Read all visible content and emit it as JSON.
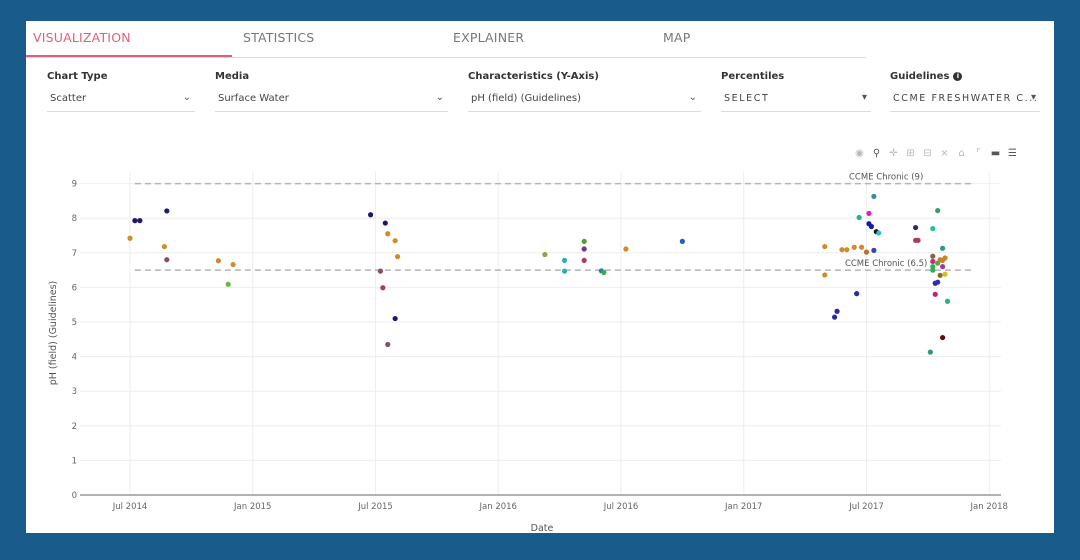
{
  "tabs": [
    {
      "label": "VISUALIZATION",
      "active": true
    },
    {
      "label": "STATISTICS",
      "active": false
    },
    {
      "label": "EXPLAINER",
      "active": false
    },
    {
      "label": "MAP",
      "active": false
    }
  ],
  "controls": {
    "chart_type": {
      "label": "Chart Type",
      "value": "Scatter"
    },
    "media": {
      "label": "Media",
      "value": "Surface Water"
    },
    "characteristics": {
      "label": "Characteristics (Y-Axis)",
      "value": "pH (field) (Guidelines)"
    },
    "percentiles": {
      "label": "Percentiles",
      "value": "SELECT"
    },
    "guidelines": {
      "label": "Guidelines",
      "value": "CCME FRESHWATER C..."
    }
  },
  "modebar": [
    "camera-icon",
    "zoom-icon",
    "pan-icon",
    "zoom-in-icon",
    "zoom-out-icon",
    "autoscale-icon",
    "reset-axes-icon",
    "spike-lines-icon",
    "hover-closest-icon",
    "hover-compare-icon"
  ],
  "colors": {
    "frame": "#195b8a",
    "accent": "#e0607a",
    "guideline": "#b5b5b5"
  },
  "chart_data": {
    "type": "scatter",
    "title": "",
    "xlabel": "Date",
    "ylabel": "pH (field) (Guidelines)",
    "xlim": [
      2014.2,
      2018.0
    ],
    "ylim": [
      0,
      9.35
    ],
    "xticks": [
      {
        "value": 2014.5,
        "label": "Jul 2014"
      },
      {
        "value": 2015.0,
        "label": "Jan 2015"
      },
      {
        "value": 2015.5,
        "label": "Jul 2015"
      },
      {
        "value": 2016.0,
        "label": "Jan 2016"
      },
      {
        "value": 2016.5,
        "label": "Jul 2016"
      },
      {
        "value": 2017.0,
        "label": "Jan 2017"
      },
      {
        "value": 2017.5,
        "label": "Jul 2017"
      },
      {
        "value": 2018.0,
        "label": "Jan 2018"
      }
    ],
    "yticks": [
      0,
      1,
      2,
      3,
      4,
      5,
      6,
      7,
      8,
      9
    ],
    "grid": true,
    "guidelines": [
      {
        "label": "CCME Chronic (9)",
        "value": 9
      },
      {
        "label": "CCME Chronic (6.5)",
        "value": 6.5
      }
    ],
    "points": [
      {
        "x": 2014.5,
        "y": 7.42,
        "color": "#d08b2b"
      },
      {
        "x": 2014.52,
        "y": 7.93,
        "color": "#1a1a6e"
      },
      {
        "x": 2014.54,
        "y": 7.93,
        "color": "#1a1a6e"
      },
      {
        "x": 2014.65,
        "y": 8.21,
        "color": "#1a1a6e"
      },
      {
        "x": 2014.64,
        "y": 7.18,
        "color": "#d08b2b"
      },
      {
        "x": 2014.65,
        "y": 6.8,
        "color": "#8e4a6e"
      },
      {
        "x": 2014.86,
        "y": 6.77,
        "color": "#d08b2b"
      },
      {
        "x": 2014.9,
        "y": 6.09,
        "color": "#6aba3a"
      },
      {
        "x": 2014.92,
        "y": 6.66,
        "color": "#d08b2b"
      },
      {
        "x": 2015.48,
        "y": 8.1,
        "color": "#1a1a6e"
      },
      {
        "x": 2015.52,
        "y": 6.47,
        "color": "#8e4a6e"
      },
      {
        "x": 2015.53,
        "y": 5.99,
        "color": "#b03a5a"
      },
      {
        "x": 2015.54,
        "y": 7.86,
        "color": "#1a1a6e"
      },
      {
        "x": 2015.55,
        "y": 7.55,
        "color": "#d08b2b"
      },
      {
        "x": 2015.55,
        "y": 4.35,
        "color": "#8e4a6e"
      },
      {
        "x": 2015.58,
        "y": 7.35,
        "color": "#d08b2b"
      },
      {
        "x": 2015.58,
        "y": 5.1,
        "color": "#1a1a6e"
      },
      {
        "x": 2015.59,
        "y": 6.89,
        "color": "#d08b2b"
      },
      {
        "x": 2016.19,
        "y": 6.95,
        "color": "#9aa042"
      },
      {
        "x": 2016.27,
        "y": 6.78,
        "color": "#2ab0b0"
      },
      {
        "x": 2016.27,
        "y": 6.47,
        "color": "#2ab0b0"
      },
      {
        "x": 2016.35,
        "y": 7.33,
        "color": "#5a9a3a"
      },
      {
        "x": 2016.35,
        "y": 7.11,
        "color": "#6a3a9a"
      },
      {
        "x": 2016.35,
        "y": 6.78,
        "color": "#b03a5a"
      },
      {
        "x": 2016.42,
        "y": 6.48,
        "color": "#2a7ac0"
      },
      {
        "x": 2016.43,
        "y": 6.43,
        "color": "#3ab04a"
      },
      {
        "x": 2016.52,
        "y": 7.11,
        "color": "#d08b2b"
      },
      {
        "x": 2016.75,
        "y": 7.33,
        "color": "#2a5ac0"
      },
      {
        "x": 2017.33,
        "y": 6.36,
        "color": "#d08b2b"
      },
      {
        "x": 2017.33,
        "y": 7.18,
        "color": "#d08b2b"
      },
      {
        "x": 2017.37,
        "y": 5.14,
        "color": "#2a2a9a"
      },
      {
        "x": 2017.38,
        "y": 5.31,
        "color": "#2a2a9a"
      },
      {
        "x": 2017.4,
        "y": 7.09,
        "color": "#d08b2b"
      },
      {
        "x": 2017.42,
        "y": 7.09,
        "color": "#d08b2b"
      },
      {
        "x": 2017.45,
        "y": 7.16,
        "color": "#d08b2b"
      },
      {
        "x": 2017.46,
        "y": 5.82,
        "color": "#2a2a9a"
      },
      {
        "x": 2017.47,
        "y": 8.02,
        "color": "#2ab08a"
      },
      {
        "x": 2017.48,
        "y": 7.16,
        "color": "#d08b2b"
      },
      {
        "x": 2017.5,
        "y": 7.02,
        "color": "#c86a2a"
      },
      {
        "x": 2017.51,
        "y": 8.14,
        "color": "#e020c0"
      },
      {
        "x": 2017.51,
        "y": 7.84,
        "color": "#1a1aa0"
      },
      {
        "x": 2017.52,
        "y": 7.76,
        "color": "#1a1aa0"
      },
      {
        "x": 2017.53,
        "y": 8.63,
        "color": "#3a8aa0"
      },
      {
        "x": 2017.53,
        "y": 7.07,
        "color": "#3a4a9a"
      },
      {
        "x": 2017.54,
        "y": 7.61,
        "color": "#111111"
      },
      {
        "x": 2017.55,
        "y": 7.57,
        "color": "#30c0d0"
      },
      {
        "x": 2017.7,
        "y": 7.73,
        "color": "#2a2a7a"
      },
      {
        "x": 2017.7,
        "y": 7.36,
        "color": "#b03a5a"
      },
      {
        "x": 2017.71,
        "y": 7.36,
        "color": "#b03a5a"
      },
      {
        "x": 2017.76,
        "y": 4.13,
        "color": "#2a9a7a"
      },
      {
        "x": 2017.77,
        "y": 7.7,
        "color": "#20c0a0"
      },
      {
        "x": 2017.77,
        "y": 6.9,
        "color": "#8a6a3a"
      },
      {
        "x": 2017.77,
        "y": 6.75,
        "color": "#c02a8a"
      },
      {
        "x": 2017.77,
        "y": 6.6,
        "color": "#3ab04a"
      },
      {
        "x": 2017.77,
        "y": 6.5,
        "color": "#2ab05a"
      },
      {
        "x": 2017.78,
        "y": 6.12,
        "color": "#2a2ab0"
      },
      {
        "x": 2017.78,
        "y": 5.8,
        "color": "#c0206a"
      },
      {
        "x": 2017.79,
        "y": 8.22,
        "color": "#3a9a6a"
      },
      {
        "x": 2017.79,
        "y": 6.7,
        "color": "#6aa02a"
      },
      {
        "x": 2017.79,
        "y": 6.15,
        "color": "#3a2ab0"
      },
      {
        "x": 2017.8,
        "y": 6.35,
        "color": "#8a6a2a"
      },
      {
        "x": 2017.8,
        "y": 6.8,
        "color": "#b08a2a"
      },
      {
        "x": 2017.81,
        "y": 7.13,
        "color": "#2a9a8a"
      },
      {
        "x": 2017.81,
        "y": 6.78,
        "color": "#d07a2a"
      },
      {
        "x": 2017.81,
        "y": 6.6,
        "color": "#9a3ab0"
      },
      {
        "x": 2017.81,
        "y": 4.55,
        "color": "#600a0a"
      },
      {
        "x": 2017.82,
        "y": 6.85,
        "color": "#c08a2a"
      },
      {
        "x": 2017.82,
        "y": 6.38,
        "color": "#d0c020"
      },
      {
        "x": 2017.83,
        "y": 5.6,
        "color": "#2ab07a"
      }
    ]
  }
}
